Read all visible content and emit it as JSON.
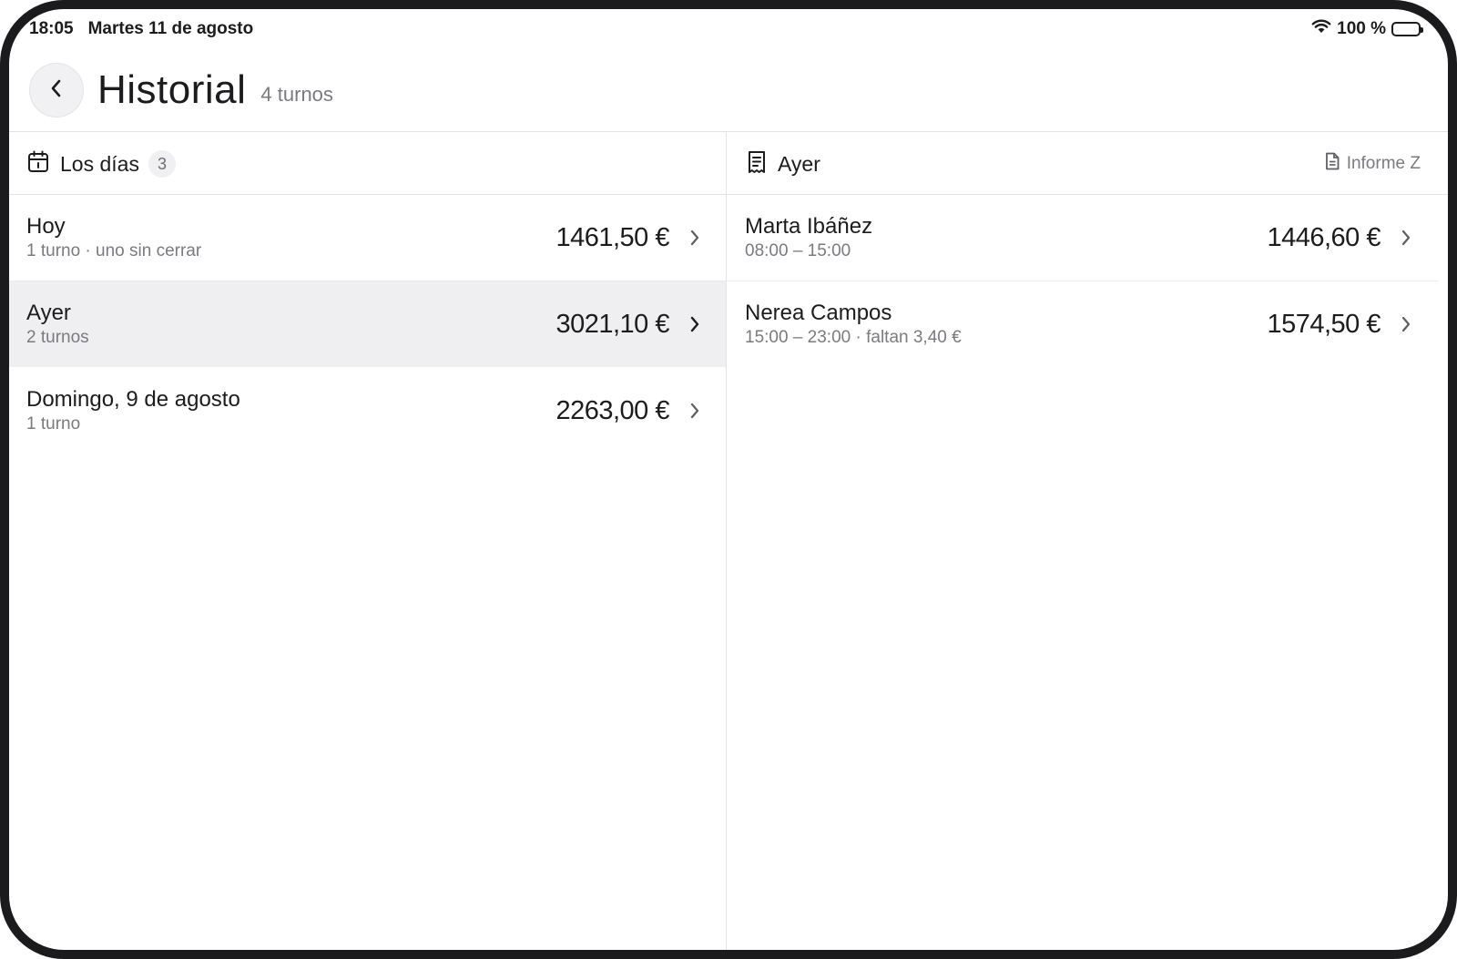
{
  "status_bar": {
    "time": "18:05",
    "date": "Martes 11 de agosto",
    "battery": "100 %"
  },
  "header": {
    "title": "Historial",
    "subtitle": "4 turnos",
    "back_icon": "chevron-left-icon"
  },
  "days_panel": {
    "label": "Los días",
    "count": "3",
    "icon": "calendar-icon",
    "items": [
      {
        "title": "Hoy",
        "subtitle": "1 turno · uno sin cerrar",
        "amount": "1461,50 €",
        "selected": false
      },
      {
        "title": "Ayer",
        "subtitle": "2 turnos",
        "amount": "3021,10 €",
        "selected": true
      },
      {
        "title": "Domingo, 9 de agosto",
        "subtitle": "1 turno",
        "amount": "2263,00 €",
        "selected": false
      }
    ]
  },
  "shifts_panel": {
    "label": "Ayer",
    "icon": "receipt-icon",
    "report_label": "Informe Z",
    "report_icon": "document-icon",
    "items": [
      {
        "title": "Marta Ibáñez",
        "subtitle": "08:00 – 15:00",
        "amount": "1446,60 €"
      },
      {
        "title": "Nerea Campos",
        "subtitle": "15:00 – 23:00 · faltan 3,40 €",
        "amount": "1574,50 €"
      }
    ]
  },
  "colors": {
    "selected_row": "#efeff1",
    "text_primary": "#1c1c1e",
    "text_secondary": "#7a7a80",
    "divider": "#e3e3e6"
  }
}
